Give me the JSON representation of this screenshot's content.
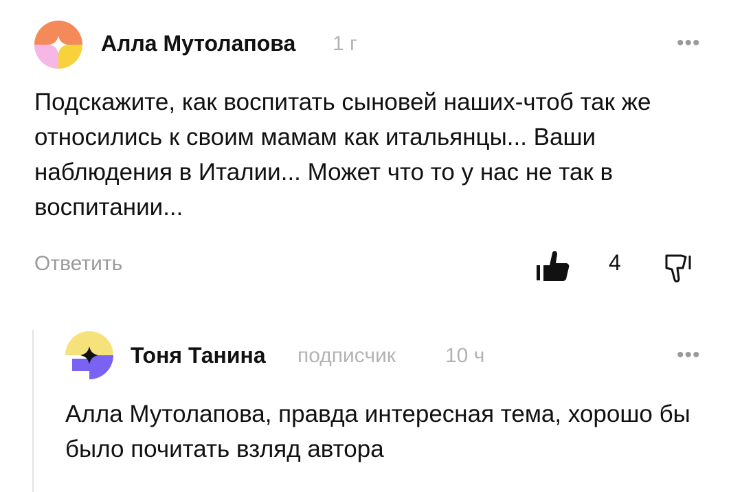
{
  "comment": {
    "author": "Алла Мутолапова",
    "time": "1 г",
    "text": "Подскажите, как воспитать сыновей наших-чтоб так же относились к своим мамам как итальянцы... Ваши наблюдения  в Италии... Может что то у нас не так в воспитании...",
    "reply_label": "Ответить",
    "likes": "4",
    "more": "•••",
    "icons": {
      "avatar": "avatar-yellow-pink",
      "like": "thumbs-up-filled-icon",
      "dislike": "thumbs-down-outline-icon",
      "more": "more-icon"
    }
  },
  "reply": {
    "author": "Тоня Танина",
    "badge": "подписчик",
    "time": "10 ч",
    "text": "Алла Мутолапова, правда интересная тема, хорошо бы было почитать взляд автора",
    "more": "•••",
    "icons": {
      "avatar": "avatar-yellow-purple",
      "more": "more-icon"
    }
  },
  "colors": {
    "text": "#111111",
    "meta": "#b3b3b3",
    "muted": "#9a9a9a"
  }
}
